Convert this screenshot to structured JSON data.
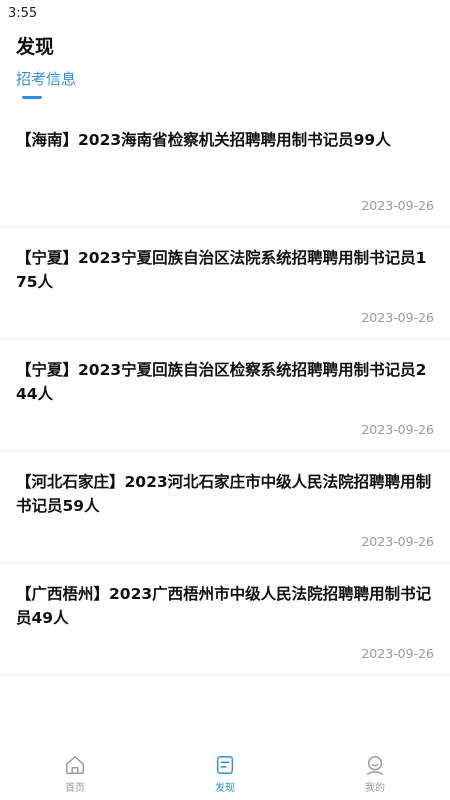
{
  "status_bar": {
    "time": "3:55"
  },
  "header": {
    "title": "发现"
  },
  "tabs": [
    {
      "label": "招考信息",
      "active": true
    }
  ],
  "articles": [
    {
      "title": "【海南】2023海南省检察机关招聘聘用制书记员99人",
      "date": "2023-09-26"
    },
    {
      "title": "【宁夏】2023宁夏回族自治区法院系统招聘聘用制书记员175人",
      "date": "2023-09-26"
    },
    {
      "title": "【宁夏】2023宁夏回族自治区检察系统招聘聘用制书记员244人",
      "date": "2023-09-26"
    },
    {
      "title": "【河北石家庄】2023河北石家庄市中级人民法院招聘聘用制书记员59人",
      "date": "2023-09-26"
    },
    {
      "title": "【广西梧州】2023广西梧州市中级人民法院招聘聘用制书记员49人",
      "date": "2023-09-26"
    }
  ],
  "bottom_nav": [
    {
      "label": "首页",
      "icon": "home-icon",
      "active": false
    },
    {
      "label": "发现",
      "icon": "discover-icon",
      "active": true
    },
    {
      "label": "我的",
      "icon": "profile-icon",
      "active": false
    }
  ],
  "colors": {
    "accent": "#2f8fe8",
    "inactive": "#9b9b9b",
    "date": "#9a9a9a"
  }
}
